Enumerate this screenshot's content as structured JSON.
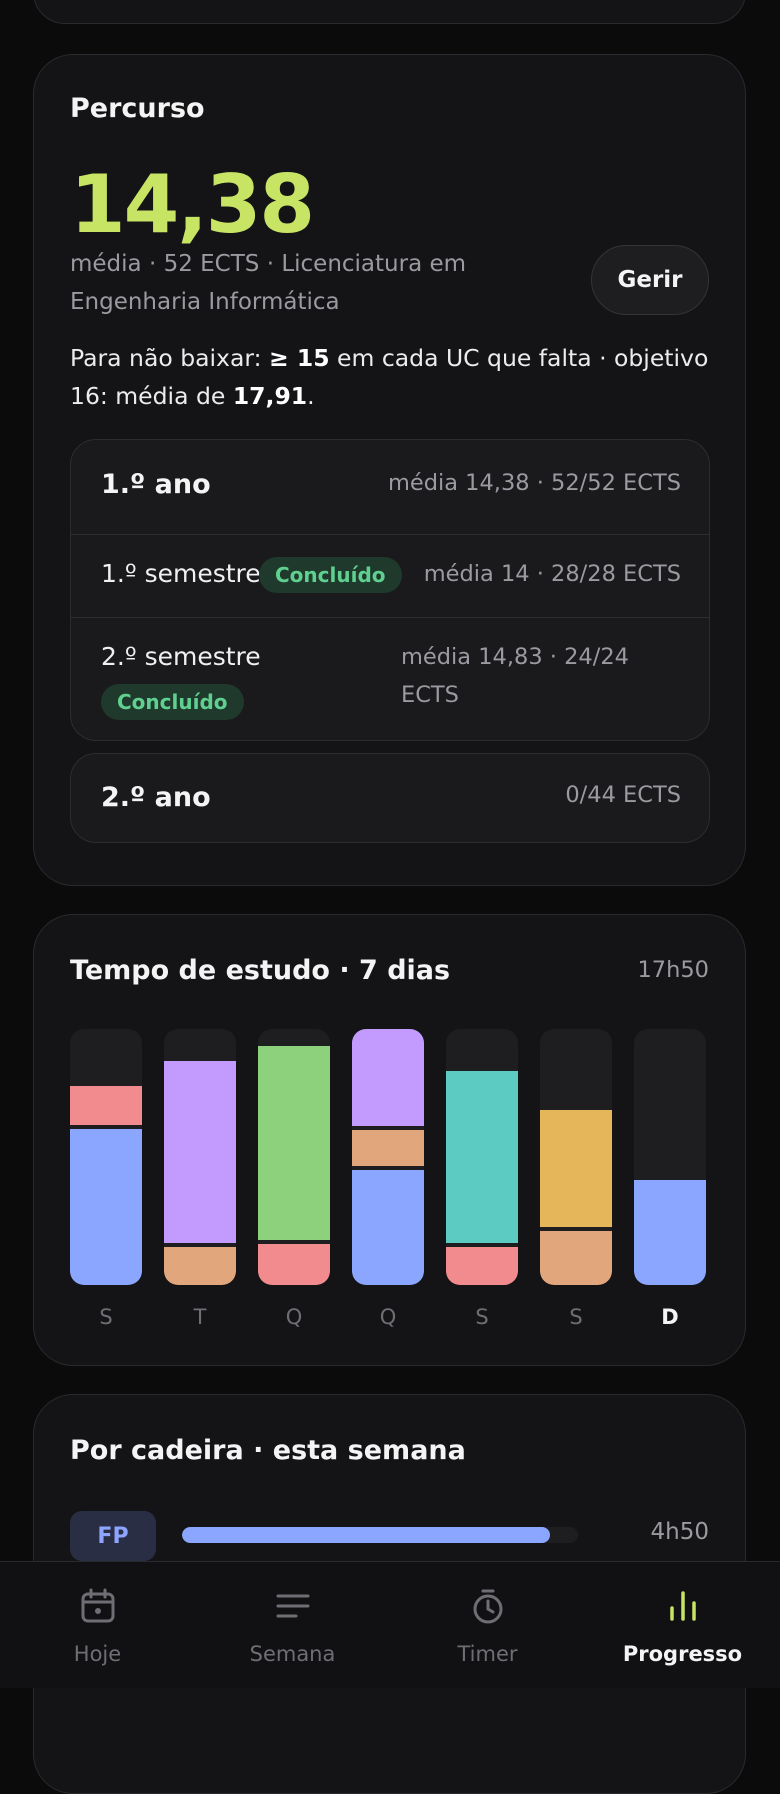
{
  "percurso": {
    "title": "Percurso",
    "average": "14,38",
    "subtitle": "média · 52 ECTS · Licenciatura em Engenharia Informática",
    "manage_label": "Gerir",
    "goal_prefix": "Para não baixar: ",
    "goal_min": "≥ 15",
    "goal_mid": " em cada UC que falta · objetivo 16: média de ",
    "goal_target": "17,91",
    "goal_suffix": ".",
    "years": [
      {
        "name": "1.º ano",
        "meta": "média 14,38 · 52/52 ECTS",
        "semesters": [
          {
            "name": "1.º semestre",
            "badge": "Concluído",
            "meta": "média 14 · 28/28 ECTS"
          },
          {
            "name": "2.º semestre",
            "badge": "Concluído",
            "meta": "média 14,83 · 24/24 ECTS"
          }
        ]
      },
      {
        "name": "2.º ano",
        "meta": "0/44 ECTS"
      }
    ]
  },
  "study": {
    "title": "Tempo de estudo · 7 dias",
    "total": "17h50",
    "days": [
      "S",
      "T",
      "Q",
      "Q",
      "S",
      "S",
      "D"
    ],
    "today_index": 6,
    "colors": {
      "blue": "#8aa6ff",
      "pink": "#f28b8d",
      "orange": "#e2a67c",
      "purple": "#c39bff",
      "green": "#8dd17c",
      "teal": "#5ccbc2",
      "yellow": "#e6b65a"
    }
  },
  "chart_data": {
    "type": "bar",
    "stacked": true,
    "categories": [
      "S",
      "T",
      "Q",
      "Q",
      "S",
      "S",
      "D"
    ],
    "series": [
      {
        "color": "#8aa6ff",
        "values": [
          0.61,
          0,
          0,
          0.45,
          0,
          0,
          0.41
        ]
      },
      {
        "color": "#f28b8d",
        "values": [
          0.15,
          0,
          0.16,
          0,
          0.15,
          0,
          0
        ]
      },
      {
        "color": "#e2a67c",
        "values": [
          0,
          0.15,
          0,
          0.14,
          0,
          0.21,
          0
        ]
      },
      {
        "color": "#c39bff",
        "values": [
          0,
          0.71,
          0,
          0.4,
          0,
          0,
          0
        ]
      },
      {
        "color": "#8dd17c",
        "values": [
          0,
          0,
          0.76,
          0,
          0,
          0,
          0
        ]
      },
      {
        "color": "#5ccbc2",
        "values": [
          0,
          0,
          0,
          0,
          0.67,
          0,
          0
        ]
      },
      {
        "color": "#e6b65a",
        "values": [
          0,
          0,
          0,
          0,
          0,
          0.46,
          0
        ]
      }
    ],
    "ylim": [
      0,
      1
    ]
  },
  "per_subject": {
    "title": "Por cadeira · esta semana",
    "items": [
      {
        "code": "FP",
        "time": "4h50",
        "fraction": 0.93,
        "color": "#8aa6ff"
      }
    ]
  },
  "nav": {
    "items": [
      {
        "label": "Hoje",
        "icon": "calendar-icon"
      },
      {
        "label": "Semana",
        "icon": "list-icon"
      },
      {
        "label": "Timer",
        "icon": "stopwatch-icon"
      },
      {
        "label": "Progresso",
        "icon": "bar-chart-icon"
      }
    ],
    "active_index": 3
  }
}
